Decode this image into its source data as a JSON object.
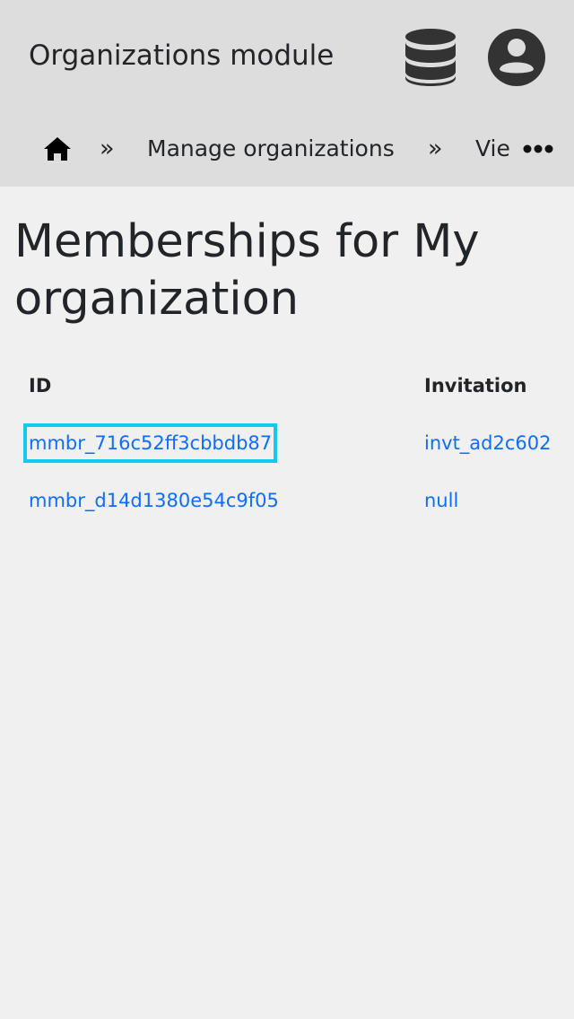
{
  "header": {
    "title": "Organizations module",
    "database_icon": "database-icon",
    "account_icon": "user-circle-icon"
  },
  "breadcrumb": {
    "home_icon": "home-icon",
    "separator": "»",
    "items": [
      {
        "label": "Manage organizations"
      },
      {
        "label": "Vie"
      }
    ],
    "more_icon": "more-horizontal-icon"
  },
  "main": {
    "title": "Memberships for My organization",
    "table": {
      "columns": [
        "ID",
        "Invitation"
      ],
      "rows": [
        {
          "id": "mmbr_716c52ff3cbbdb87",
          "invitation": "invt_ad2c602"
        },
        {
          "id": "mmbr_d14d1380e54c9f05",
          "invitation": "null"
        }
      ]
    }
  },
  "colors": {
    "header_bg": "#dddddd",
    "page_bg": "#f0f0f0",
    "link": "#0d6efd",
    "focus_ring": "#14c8ee",
    "text": "#212529"
  }
}
